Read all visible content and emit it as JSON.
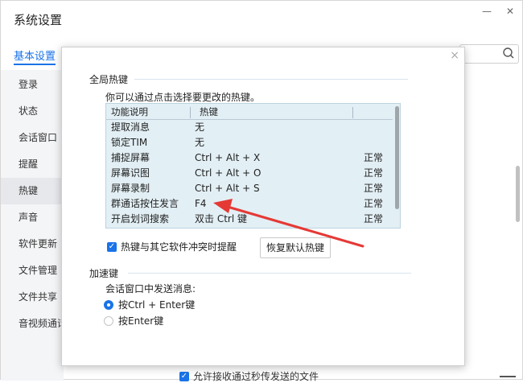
{
  "window": {
    "title": "系统设置",
    "minimize": "—",
    "close": "✕"
  },
  "tabs": {
    "basic": "基本设置"
  },
  "sidebar": {
    "items": [
      "登录",
      "状态",
      "会话窗口",
      "提醒",
      "热键",
      "声音",
      "软件更新",
      "文件管理",
      "文件共享",
      "音视频通话"
    ]
  },
  "dialog": {
    "section_hotkeys": "全局热键",
    "hint": "你可以通过点击选择要更改的热键。",
    "table": {
      "columns": [
        "功能说明",
        "热键"
      ],
      "rows": [
        {
          "desc": "提取消息",
          "key": "无",
          "status": ""
        },
        {
          "desc": "锁定TIM",
          "key": "无",
          "status": ""
        },
        {
          "desc": "捕捉屏幕",
          "key": "Ctrl + Alt + X",
          "status": "正常"
        },
        {
          "desc": "屏幕识图",
          "key": "Ctrl + Alt + O",
          "status": "正常"
        },
        {
          "desc": "屏幕录制",
          "key": "Ctrl + Alt + S",
          "status": "正常"
        },
        {
          "desc": "群通话按住发言",
          "key": "F4",
          "status": "正常"
        },
        {
          "desc": "开启划词搜索",
          "key": "双击 Ctrl 键",
          "status": "正常"
        }
      ]
    },
    "conflict_label": "热键与其它软件冲突时提醒",
    "restore_button": "恢复默认热键",
    "section_accel": "加速键",
    "send_label": "会话窗口中发送消息:",
    "radio_ctrl_enter": "按Ctrl + Enter键",
    "radio_enter": "按Enter键",
    "close": "×"
  },
  "bottom": {
    "allow_receive": "允许接收通过秒传发送的文件"
  },
  "colors": {
    "accent": "#1a73e8",
    "arrow": "#e53935",
    "table_bg": "#e2eff5"
  }
}
